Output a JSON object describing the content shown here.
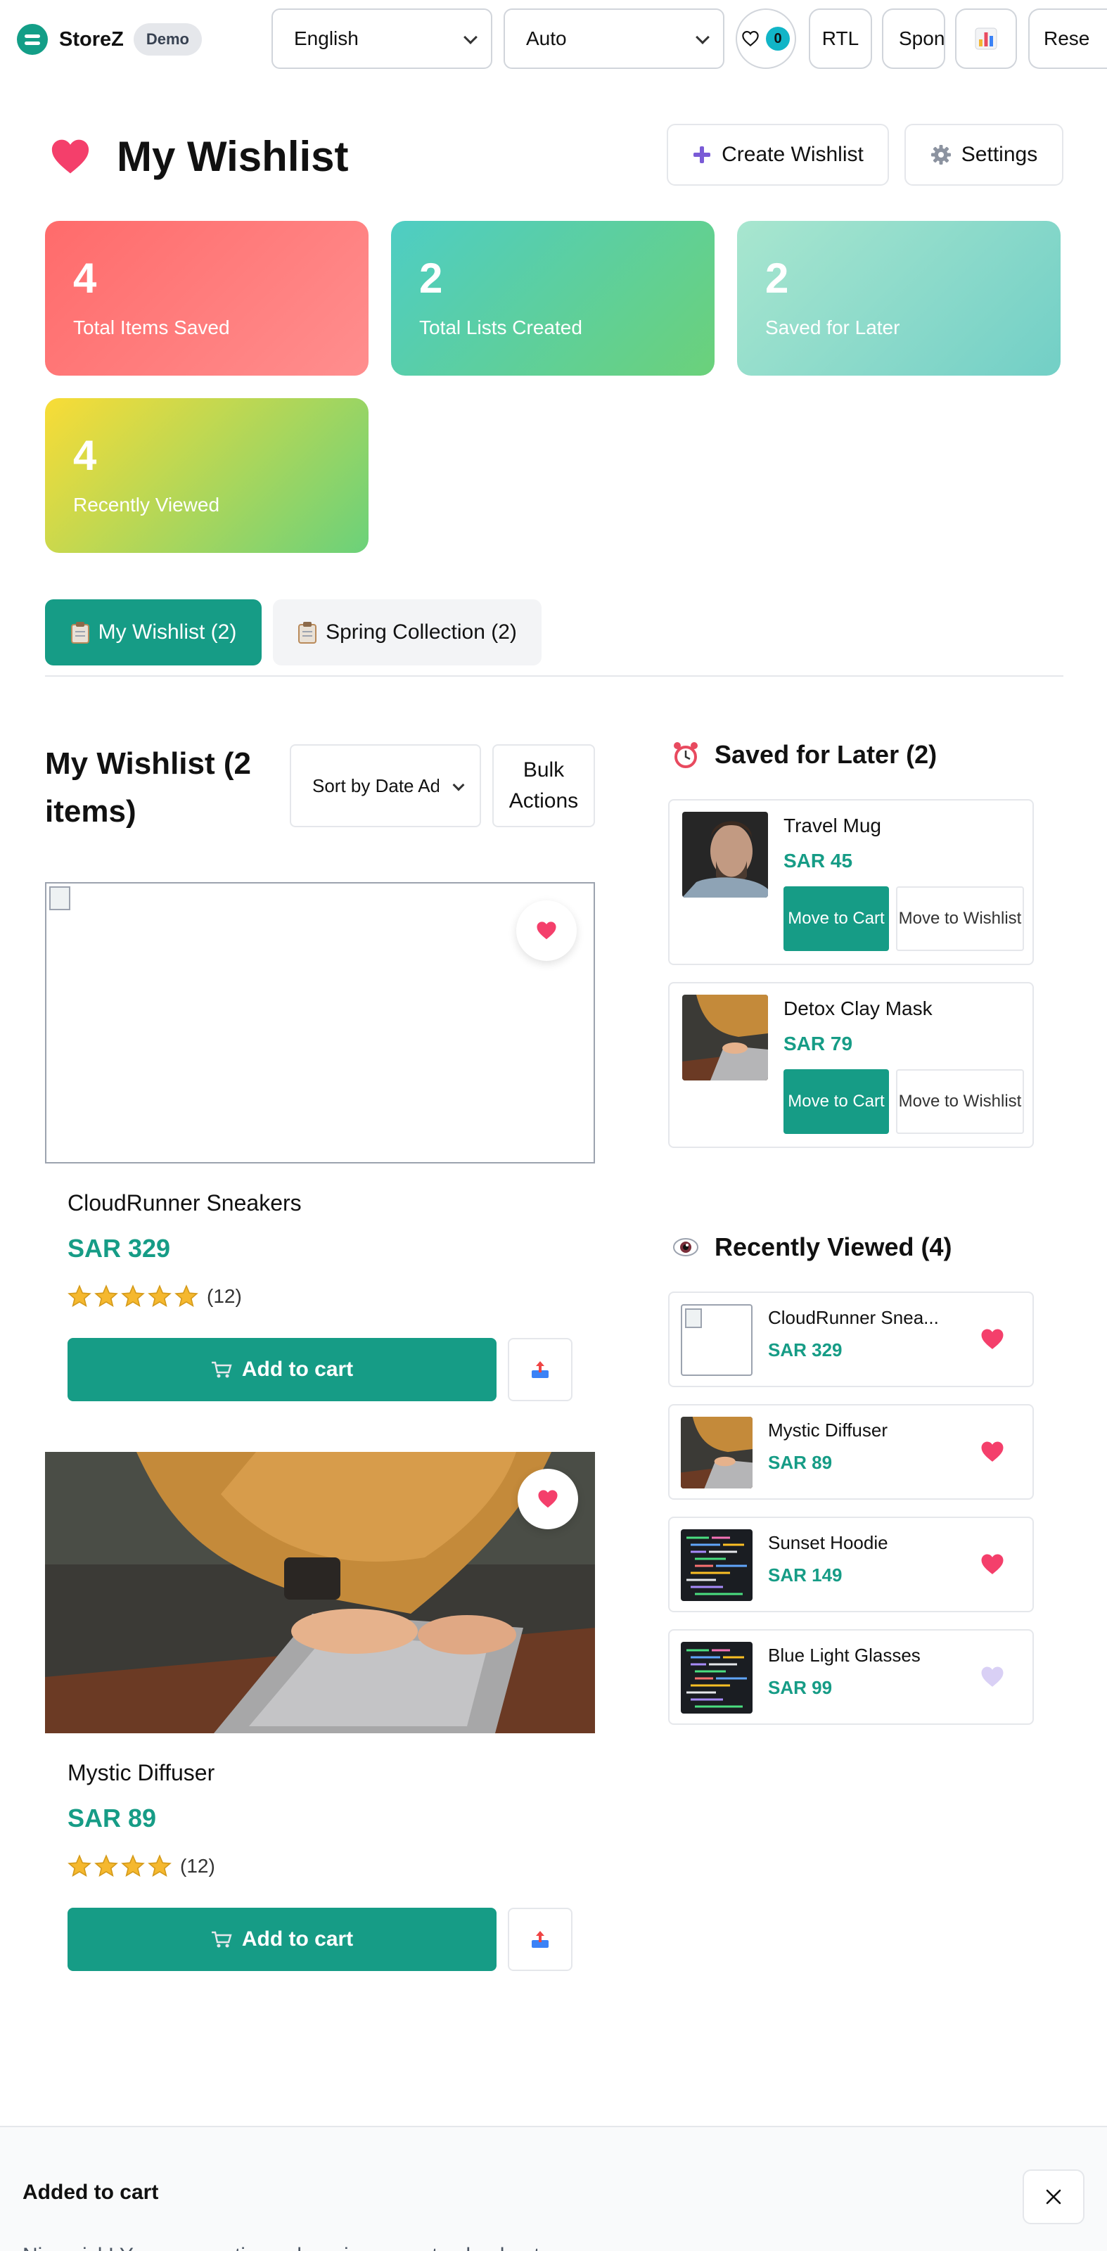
{
  "topbar": {
    "brand": "StoreZ",
    "badge": "Demo",
    "language": "English",
    "theme": "Auto",
    "wishlist_count": "0",
    "rtl_label": "RTL",
    "sponsor_label": "Sponsor",
    "reset_label": "Rese"
  },
  "header": {
    "title": "My Wishlist",
    "create_label": "Create Wishlist",
    "settings_label": "Settings"
  },
  "stats": [
    {
      "value": "4",
      "label": "Total Items Saved"
    },
    {
      "value": "2",
      "label": "Total Lists Created"
    },
    {
      "value": "2",
      "label": "Saved for Later"
    },
    {
      "value": "4",
      "label": "Recently Viewed"
    }
  ],
  "tabs": [
    {
      "label": "My Wishlist (2)"
    },
    {
      "label": "Spring Collection (2)"
    }
  ],
  "wishlist": {
    "title": "My Wishlist (2 items)",
    "sort_value": "Sort by Date Added",
    "bulk_label": "Bulk Actions",
    "cart_label": "Add to cart",
    "items": [
      {
        "name": "CloudRunner Sneakers",
        "price": "SAR 329",
        "rating": 5,
        "reviews": "(12)"
      },
      {
        "name": "Mystic Diffuser",
        "price": "SAR 89",
        "rating": 4,
        "reviews": "(12)"
      }
    ]
  },
  "saved_later": {
    "title": "Saved for Later (2)",
    "move_cart_label": "Move to Cart",
    "move_wishlist_label": "Move to Wishlist",
    "items": [
      {
        "name": "Travel Mug",
        "price": "SAR 45"
      },
      {
        "name": "Detox Clay Mask",
        "price": "SAR 79"
      }
    ]
  },
  "recently_viewed": {
    "title": "Recently Viewed (4)",
    "items": [
      {
        "name": "CloudRunner Snea...",
        "price": "SAR 329",
        "wishlisted": true
      },
      {
        "name": "Mystic Diffuser",
        "price": "SAR 89",
        "wishlisted": true
      },
      {
        "name": "Sunset Hoodie",
        "price": "SAR 149",
        "wishlisted": true
      },
      {
        "name": "Blue Light Glasses",
        "price": "SAR 99",
        "wishlisted": false
      }
    ]
  },
  "toast": {
    "title": "Added to cart",
    "message": "Nice pick! You can continue shopping or go to checkout."
  },
  "colors": {
    "accent": "#169c86",
    "heart": "#f43f6b",
    "heart_inactive": "#d9d0f5"
  }
}
